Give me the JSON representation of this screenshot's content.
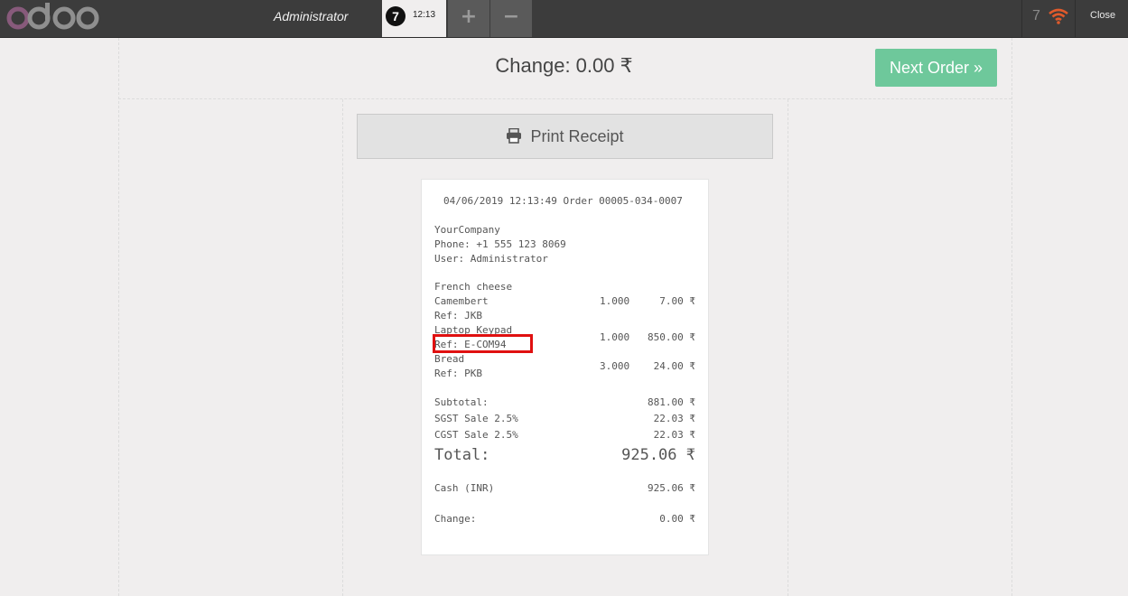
{
  "topbar": {
    "logo": "odoo",
    "cashier": "Administrator",
    "order_sequence": "7",
    "order_time": "12:13",
    "add_label": "+",
    "remove_label": "−",
    "sync_count": "7",
    "close_label": "Close"
  },
  "screen": {
    "change_text": "Change: 0.00 ₹",
    "next_order_label": "Next Order »",
    "print_label": "Print Receipt"
  },
  "receipt": {
    "header": "04/06/2019 12:13:49 Order 00005-034-0007",
    "company": "YourCompany",
    "phone": "Phone: +1 555 123 8069",
    "user": "User: Administrator",
    "lines": [
      {
        "name": "French cheese",
        "name2": "Camembert",
        "qty": "1.000",
        "price": "7.00 ₹",
        "ref": "Ref: JKB"
      },
      {
        "name": "Laptop Keypad",
        "qty": "1.000",
        "price": "850.00 ₹",
        "ref": "Ref: E-COM94"
      },
      {
        "name": "Bread",
        "qty": "3.000",
        "price": "24.00 ₹",
        "ref": "Ref: PKB"
      }
    ],
    "subtotal_label": "Subtotal:",
    "subtotal": "881.00 ₹",
    "tax1_label": "SGST Sale 2.5%",
    "tax1": "22.03 ₹",
    "tax2_label": "CGST Sale 2.5%",
    "tax2": "22.03 ₹",
    "total_label": "Total:",
    "total": "925.06 ₹",
    "payment_label": "Cash (INR)",
    "payment": "925.06 ₹",
    "change_label": "Change:",
    "change": "0.00 ₹"
  },
  "colors": {
    "topbar": "#3c3c3c",
    "logo": "#875a7b",
    "next_order": "#6ec89b",
    "wifi": "#e05a2b",
    "highlight": "#e01010"
  }
}
